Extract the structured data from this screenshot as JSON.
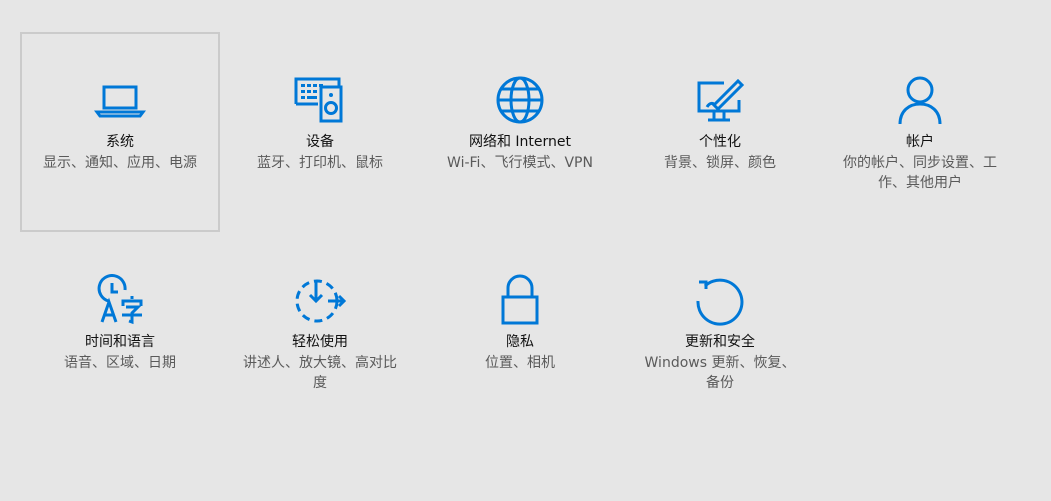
{
  "accent_color": "#0078d7",
  "tiles": [
    {
      "name": "system",
      "icon": "laptop-icon",
      "title": "系统",
      "desc": "显示、通知、应用、电源"
    },
    {
      "name": "devices",
      "icon": "devices-icon",
      "title": "设备",
      "desc": "蓝牙、打印机、鼠标"
    },
    {
      "name": "network",
      "icon": "globe-icon",
      "title": "网络和 Internet",
      "desc": "Wi-Fi、飞行模式、VPN"
    },
    {
      "name": "personalization",
      "icon": "personalization-icon",
      "title": "个性化",
      "desc": "背景、锁屏、颜色"
    },
    {
      "name": "accounts",
      "icon": "person-icon",
      "title": "帐户",
      "desc": "你的帐户、同步设置、工作、其他用户"
    },
    {
      "name": "time-language",
      "icon": "time-language-icon",
      "title": "时间和语言",
      "desc": "语音、区域、日期"
    },
    {
      "name": "ease-of-access",
      "icon": "ease-of-access-icon",
      "title": "轻松使用",
      "desc": "讲述人、放大镜、高对比度"
    },
    {
      "name": "privacy",
      "icon": "lock-icon",
      "title": "隐私",
      "desc": "位置、相机"
    },
    {
      "name": "update-security",
      "icon": "refresh-icon",
      "title": "更新和安全",
      "desc": "Windows 更新、恢复、备份"
    }
  ]
}
